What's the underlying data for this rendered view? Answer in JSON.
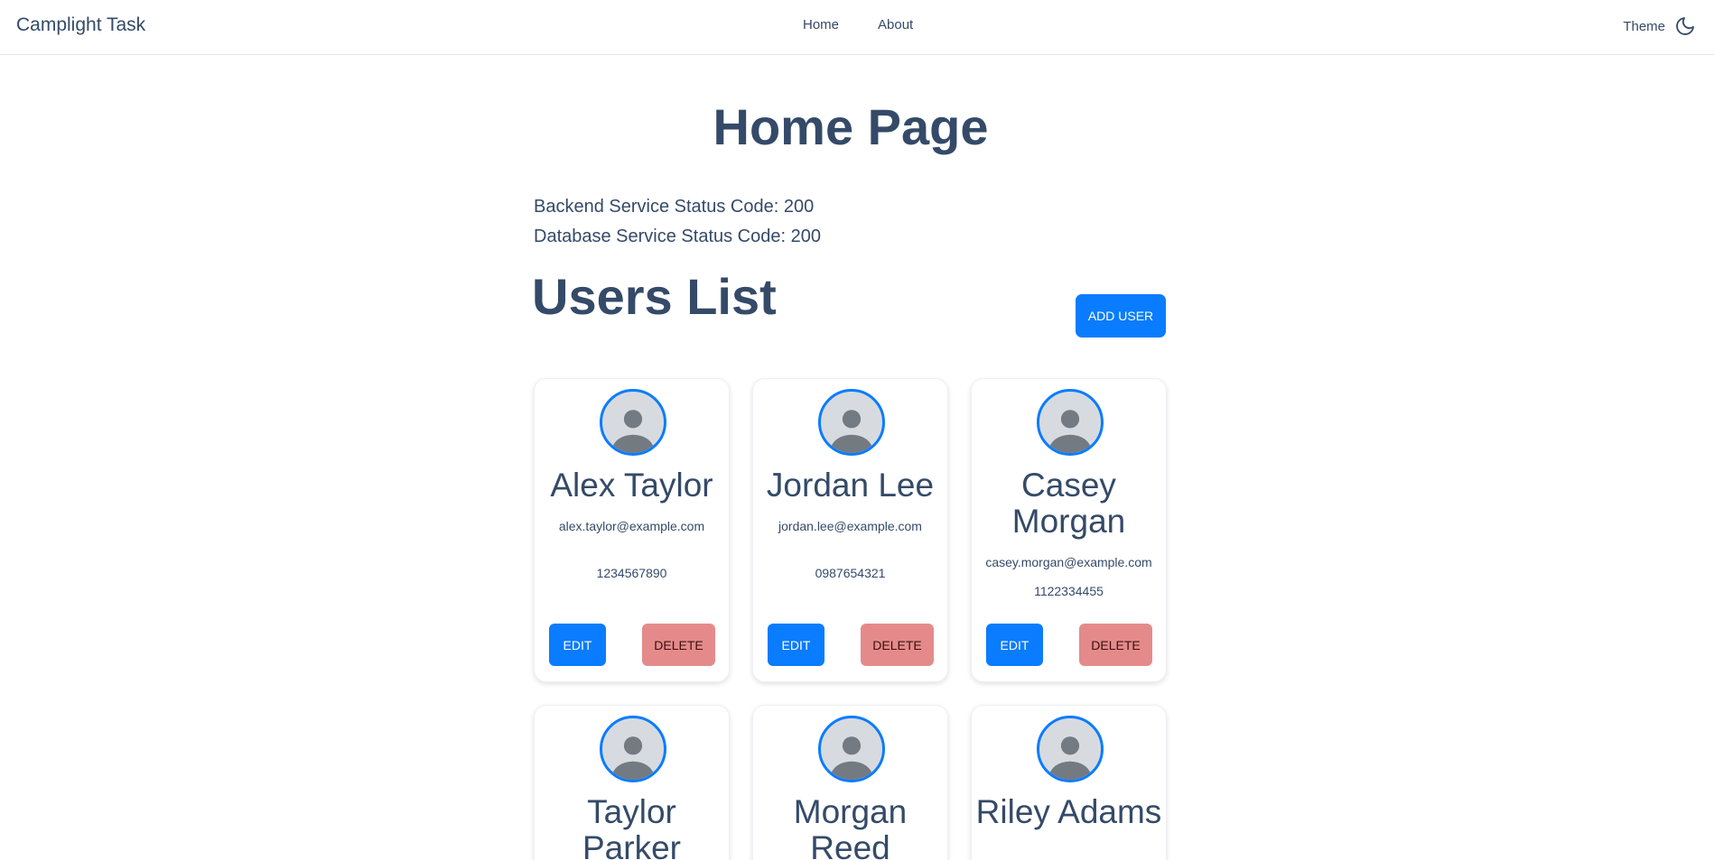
{
  "nav": {
    "brand": "Camplight Task",
    "links": [
      "Home",
      "About"
    ],
    "theme_label": "Theme",
    "theme_icon": "moon-icon"
  },
  "main": {
    "title": "Home Page",
    "backend_status": "Backend Service Status Code: 200",
    "database_status": "Database Service Status Code: 200",
    "users_title": "Users List",
    "add_user_label": "ADD USER"
  },
  "users": [
    {
      "name": "Alex Taylor",
      "email": "alex.taylor@example.com",
      "phone": "1234567890"
    },
    {
      "name": "Jordan Lee",
      "email": "jordan.lee@example.com",
      "phone": "0987654321"
    },
    {
      "name": "Casey Morgan",
      "email": "casey.morgan@example.com",
      "phone": "1122334455"
    },
    {
      "name": "Taylor Parker"
    },
    {
      "name": "Morgan Reed"
    },
    {
      "name": "Riley Adams"
    }
  ],
  "card_actions": {
    "edit_label": "EDIT",
    "delete_label": "DELETE"
  },
  "colors": {
    "primary": "#0a7cff",
    "danger": "#e58a8a",
    "text": "#344a68"
  }
}
